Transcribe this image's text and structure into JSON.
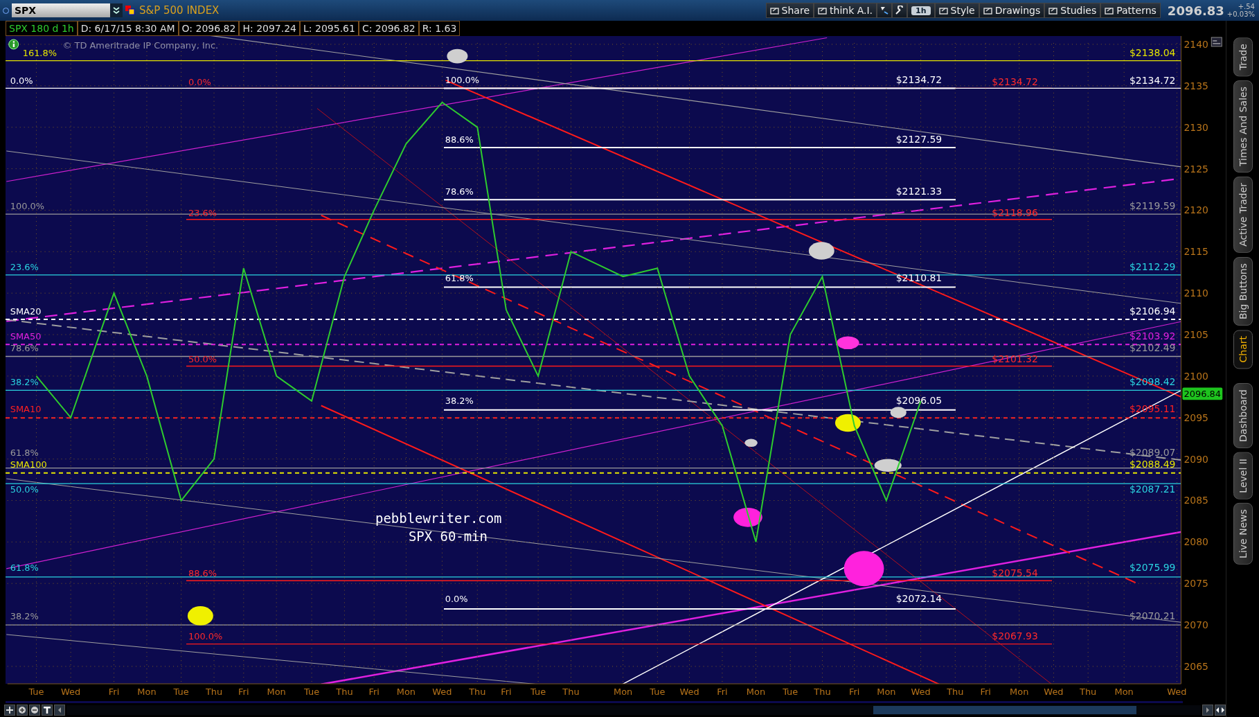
{
  "toolbar": {
    "symbol": "SPX",
    "name": "S&P 500 INDEX",
    "buttons": [
      {
        "kind": "text",
        "label": "Share"
      },
      {
        "kind": "text",
        "label": "think A.I."
      },
      {
        "kind": "icon"
      },
      {
        "kind": "icon"
      },
      {
        "kind": "badge",
        "label": "1h"
      },
      {
        "kind": "text",
        "label": "Style"
      },
      {
        "kind": "text",
        "label": "Drawings"
      },
      {
        "kind": "text",
        "label": "Studies"
      },
      {
        "kind": "text",
        "label": "Patterns"
      }
    ],
    "last": "2096.83",
    "change": "+.54",
    "change_pct": "+0.03%"
  },
  "info_bar": [
    "SPX 180 d 1h",
    "D: 6/17/15 8:30 AM",
    "O: 2096.82",
    "H: 2097.24",
    "L: 2095.61",
    "C: 2096.82",
    "R: 1.63"
  ],
  "chart": {
    "copyright": "© TD Ameritrade IP Company, Inc.",
    "annotation": [
      "pebblewriter.com",
      "SPX 60-min"
    ],
    "current_price": "2096.84",
    "chart_data": {
      "type": "line",
      "categories": [
        "Tue",
        "Wed",
        "Fri",
        "Mon",
        "Tue",
        "Thu",
        "Fri",
        "Mon",
        "Tue",
        "Thu",
        "Fri",
        "Mon",
        "Wed",
        "Thu",
        "Fri",
        "Tue",
        "Thu",
        "Mon",
        "Tue",
        "Wed",
        "Fri",
        "Mon",
        "Tue",
        "Thu",
        "Fri",
        "Mon",
        "Wed",
        "Thu",
        "Fri",
        "Mon",
        "Wed",
        "Thu",
        "Mon",
        "Wed"
      ],
      "series": [
        {
          "color": "#2ecc2e",
          "values": [
            2100,
            2095,
            2110,
            2100,
            2085,
            2090,
            2113,
            2100,
            2097,
            2112,
            2120,
            2128,
            2133,
            2130,
            2108,
            2100,
            2115,
            2112,
            2113,
            2100,
            2094,
            2080,
            2105,
            2112,
            2094,
            2085,
            2097,
            null,
            null,
            null,
            null,
            null,
            null,
            null
          ]
        }
      ],
      "ylim": [
        2062.9,
        2141
      ],
      "grid": true,
      "yticks": [
        2065,
        2070,
        2075,
        2080,
        2085,
        2090,
        2095,
        2100,
        2105,
        2110,
        2115,
        2120,
        2125,
        2130,
        2135,
        2140
      ]
    },
    "levels": [
      {
        "kind": "fib",
        "label": "161.8%",
        "price": "$2138.04",
        "color": "#e6e600"
      },
      {
        "kind": "fib",
        "label": "0.0%",
        "price": "$2134.72",
        "color": "#ffffff"
      },
      {
        "kind": "fib",
        "label": "100.0%",
        "price": "$2119.59",
        "color": "#9a9a9a"
      },
      {
        "kind": "fib",
        "label": "23.6%",
        "price": "$2112.29",
        "color": "#2ad4e0"
      },
      {
        "kind": "sma",
        "label": "SMA20",
        "price": "$2106.94",
        "color": "#ffffff"
      },
      {
        "kind": "sma",
        "label": "SMA50",
        "price": "$2103.92",
        "color": "#e020e0"
      },
      {
        "kind": "fib",
        "label": "78.6%",
        "price": "$2102.49",
        "color": "#9a9a9a"
      },
      {
        "kind": "fib",
        "label": "38.2%",
        "price": "$2098.42",
        "color": "#2ad4e0"
      },
      {
        "kind": "sma",
        "label": "SMA10",
        "price": "$2095.11",
        "color": "#ff2020"
      },
      {
        "kind": "fib",
        "label": "61.8%",
        "price": "$2089.07",
        "color": "#9a9a9a"
      },
      {
        "kind": "sma",
        "label": "SMA100",
        "price": "$2088.49",
        "color": "#e6e600"
      },
      {
        "kind": "fib",
        "label": "50.0%",
        "price": "$2087.21",
        "color": "#2ad4e0"
      },
      {
        "kind": "fib",
        "label": "61.8%",
        "price": "$2075.99",
        "color": "#2ad4e0"
      },
      {
        "kind": "fib",
        "label": "38.2%",
        "price": "$2070.21",
        "color": "#9a9a9a"
      }
    ],
    "red_fib": [
      {
        "label": "0.0%",
        "price": "$2134.72"
      },
      {
        "label": "23.6%",
        "price": "$2118.96"
      },
      {
        "label": "50.0%",
        "price": "$2101.32"
      },
      {
        "label": "88.6%",
        "price": "$2075.54"
      },
      {
        "label": "100.0%",
        "price": "$2067.93"
      }
    ],
    "white_fib": [
      {
        "label": "100.0%",
        "price": "$2134.72"
      },
      {
        "label": "88.6%",
        "price": "$2127.59"
      },
      {
        "label": "78.6%",
        "price": "$2121.33"
      },
      {
        "label": "61.8%",
        "price": "$2110.81"
      },
      {
        "label": "38.2%",
        "price": "$2096.05"
      },
      {
        "label": "0.0%",
        "price": "$2072.14"
      }
    ]
  },
  "side_tabs": [
    {
      "label": "Trade",
      "selected": false
    },
    {
      "label": "Times And Sales",
      "selected": false
    },
    {
      "label": "Active Trader",
      "selected": false
    },
    {
      "label": "Big Buttons",
      "selected": false
    },
    {
      "label": "Chart",
      "selected": true
    },
    {
      "label": "Dashboard",
      "selected": false
    },
    {
      "label": "Level II",
      "selected": false
    },
    {
      "label": "Live News",
      "selected": false
    }
  ]
}
